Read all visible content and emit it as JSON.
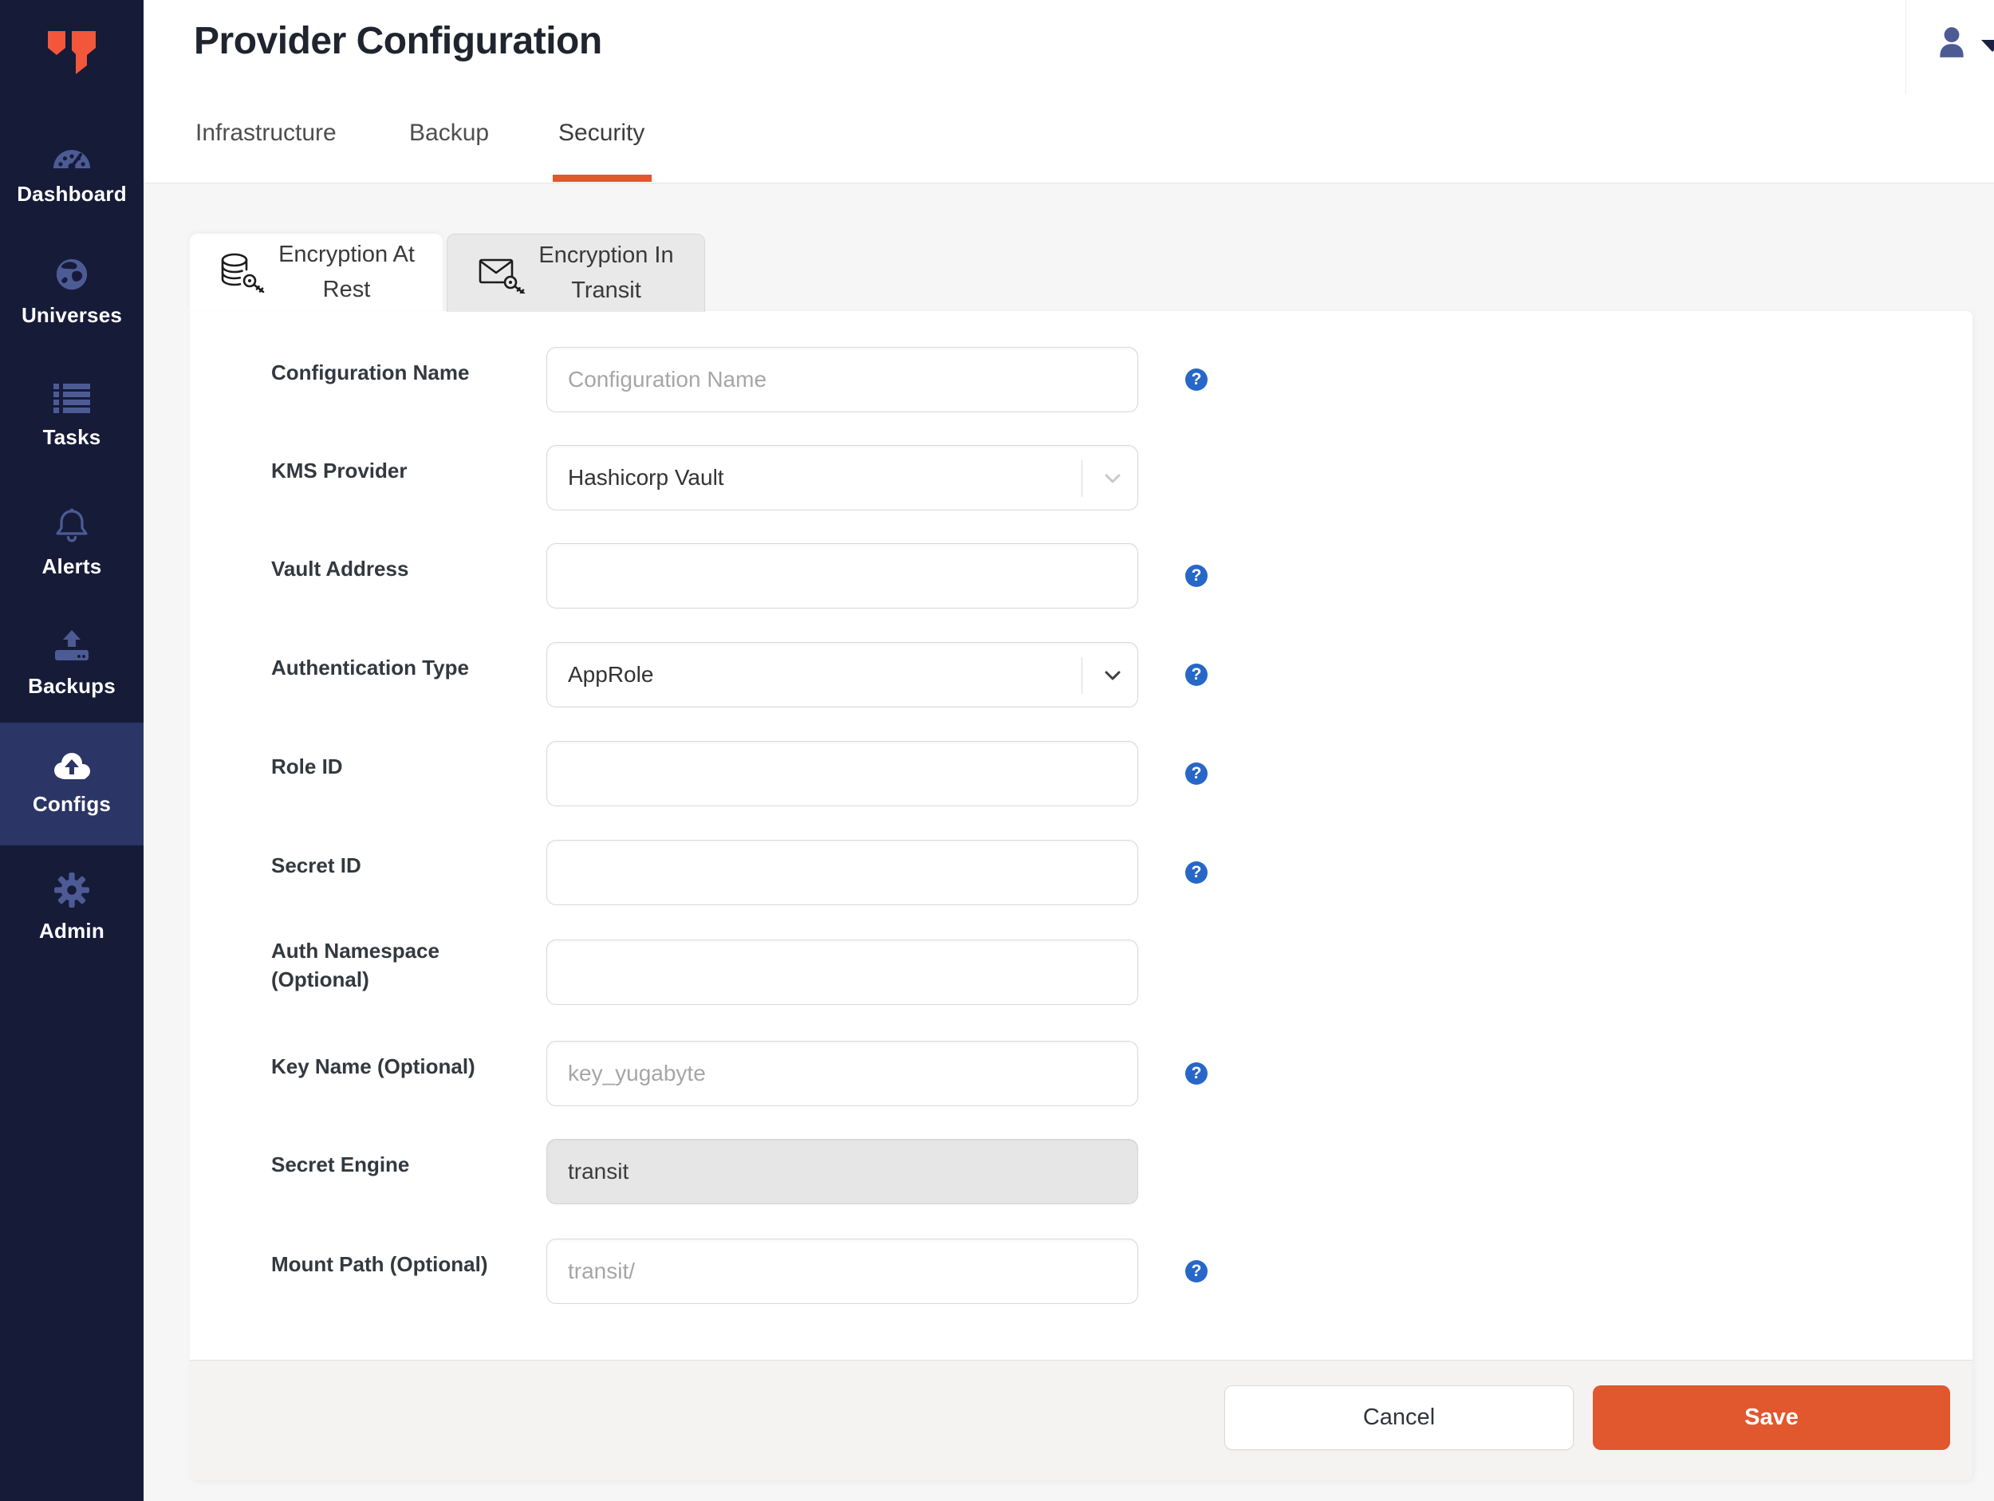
{
  "theme": {
    "accent-orange": "#E1572E",
    "logo-orange": "#F2563B",
    "help-blue": "#2767C8",
    "sidebar-bg": "#161B38",
    "sidebar-active": "#2B3566",
    "icon-muted": "#4D5B95",
    "page-bg": "#F6F6F6",
    "footer-bg": "#F4F3F1"
  },
  "sidebar": {
    "items": [
      {
        "label": "Dashboard",
        "icon": "dashboard-gauge-icon",
        "active": false
      },
      {
        "label": "Universes",
        "icon": "universes-globe-icon",
        "active": false
      },
      {
        "label": "Tasks",
        "icon": "tasks-list-icon",
        "active": false
      },
      {
        "label": "Alerts",
        "icon": "alerts-bell-icon",
        "active": false
      },
      {
        "label": "Backups",
        "icon": "backups-upload-icon",
        "active": false
      },
      {
        "label": "Configs",
        "icon": "configs-cloud-upload-icon",
        "active": true
      },
      {
        "label": "Admin",
        "icon": "admin-gear-icon",
        "active": false
      }
    ]
  },
  "header": {
    "title": "Provider Configuration",
    "tabs": [
      {
        "label": "Infrastructure",
        "active": false
      },
      {
        "label": "Backup",
        "active": false
      },
      {
        "label": "Security",
        "active": true
      }
    ],
    "user_menu": {
      "icon": "user-icon",
      "caret": "caret-down-icon"
    }
  },
  "subtabs": [
    {
      "lines": [
        "Encryption At",
        "Rest"
      ],
      "icon": "database-key-icon",
      "active": true
    },
    {
      "lines": [
        "Encryption In",
        "Transit"
      ],
      "icon": "envelope-key-icon",
      "active": false
    }
  ],
  "form": {
    "help_glyph": "?",
    "rows": [
      {
        "label": "Configuration Name",
        "control": "text",
        "placeholder": "Configuration Name",
        "value": "",
        "help": true
      },
      {
        "label": "KMS Provider",
        "control": "select",
        "value": "Hashicorp Vault",
        "help": false
      },
      {
        "label": "Vault Address",
        "control": "text",
        "placeholder": "",
        "value": "",
        "help": true
      },
      {
        "label": "Authentication Type",
        "control": "select",
        "value": "AppRole",
        "help": true
      },
      {
        "label": "Role ID",
        "control": "text",
        "placeholder": "",
        "value": "",
        "help": true
      },
      {
        "label": "Secret ID",
        "control": "text",
        "placeholder": "",
        "value": "",
        "help": true
      },
      {
        "label": "Auth Namespace (Optional)",
        "label_lines": [
          "Auth Namespace",
          "(Optional)"
        ],
        "control": "text",
        "placeholder": "",
        "value": "",
        "help": false
      },
      {
        "label": "Key Name (Optional)",
        "control": "text",
        "placeholder": "key_yugabyte",
        "value": "",
        "help": true
      },
      {
        "label": "Secret Engine",
        "control": "text-disabled",
        "value": "transit",
        "help": false
      },
      {
        "label": "Mount Path (Optional)",
        "control": "text",
        "placeholder": "transit/",
        "value": "",
        "help": true
      }
    ]
  },
  "footer": {
    "cancel_label": "Cancel",
    "save_label": "Save"
  }
}
